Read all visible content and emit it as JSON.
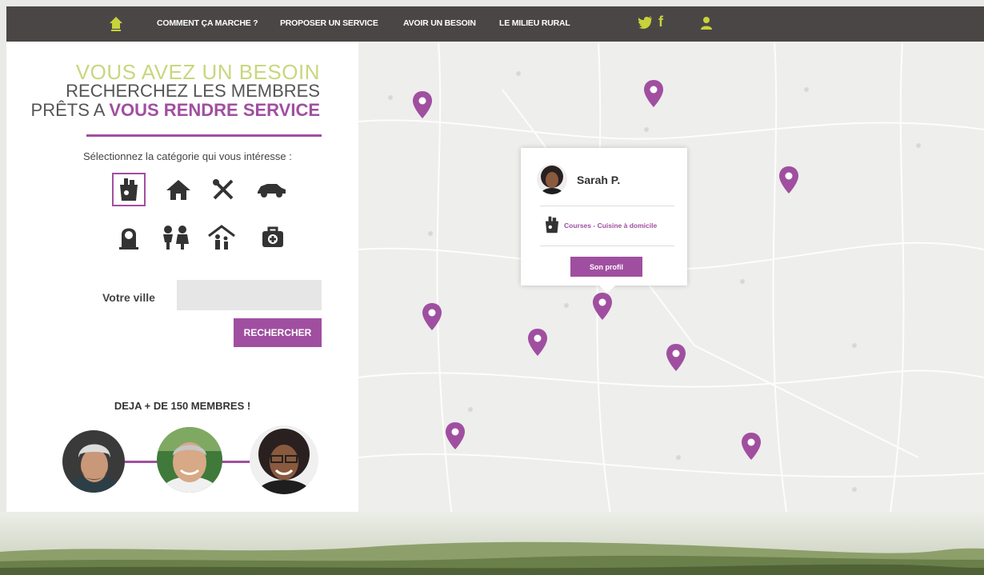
{
  "nav": {
    "items": [
      "COMMENT ÇA MARCHE ?",
      "PROPOSER UN SERVICE",
      "AVOIR UN BESOIN",
      "LE MILIEU RURAL"
    ]
  },
  "hero": {
    "line1": "VOUS AVEZ UN BESOIN",
    "line2": "RECHERCHEZ LES MEMBRES",
    "line3_prefix": "PRÊTS A ",
    "line3_bold": "VOUS RENDRE SERVICE"
  },
  "category_label": "Sélectionnez la catégorie qui vous intéresse :",
  "categories": [
    "courses-icon",
    "home-icon",
    "tools-icon",
    "car-icon",
    "senior-icon",
    "children-icon",
    "family-home-icon",
    "medical-icon"
  ],
  "city": {
    "label": "Votre ville",
    "value": "",
    "placeholder": ""
  },
  "search_button": "RECHERCHER",
  "members_label": "DEJA + DE 150 MEMBRES !",
  "popup": {
    "name": "Sarah P.",
    "service": "Courses - Cuisine à domicile",
    "button": "Son profil"
  },
  "colors": {
    "accent": "#a04fa0",
    "nav_bg": "#4a4646",
    "highlight": "#c8d77e"
  }
}
